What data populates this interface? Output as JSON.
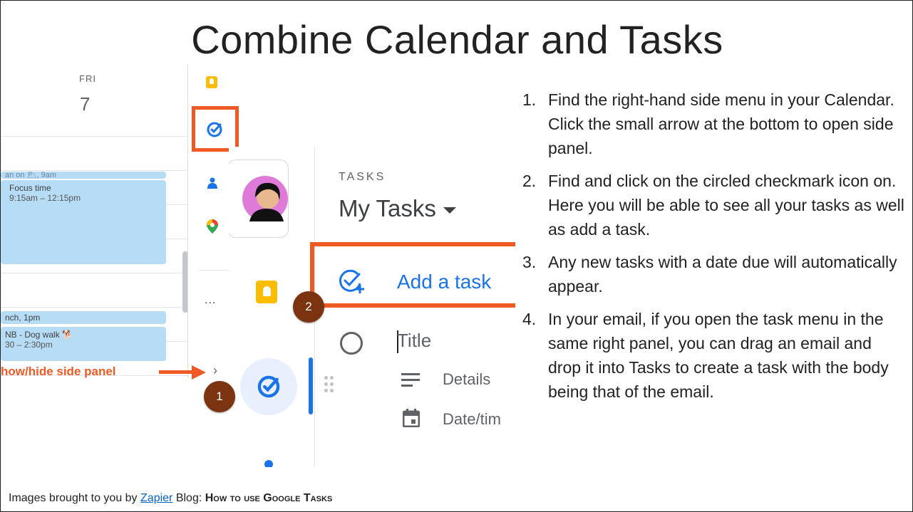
{
  "slide": {
    "title": "Combine Calendar and Tasks"
  },
  "calendar": {
    "day_name": "FRI",
    "day_number": "7",
    "events": [
      {
        "text": "an on 🌥, 9am"
      },
      {
        "title": "Focus time",
        "time": "9:15am – 12:15pm"
      },
      {
        "text": "nch, 1pm"
      },
      {
        "title": "NB - Dog walk 🐕",
        "time": "30 – 2:30pm"
      }
    ],
    "show_hide_label": "how/hide side panel"
  },
  "rail": {
    "more_label": "...",
    "expand_chevron": "›",
    "icons": [
      "keep-icon",
      "tasks-icon",
      "contacts-icon",
      "maps-icon"
    ]
  },
  "tasks_panel": {
    "section_label": "TASKS",
    "list_name": "My Tasks",
    "add_task_label": "Add a task",
    "title_placeholder": "Title",
    "details_label": "Details",
    "datetime_label": "Date/tim"
  },
  "markers": {
    "one": "1",
    "two": "2"
  },
  "steps": [
    {
      "num": "1.",
      "text": "Find the right-hand side menu in your Calendar. Click the small arrow at the bottom to open side panel."
    },
    {
      "num": "2.",
      "text": "Find and click on the circled checkmark icon on. Here you will be able to see all your tasks as well as add a task."
    },
    {
      "num": "3.",
      "text": "Any new tasks with a date due will automatically appear."
    },
    {
      "num": "4.",
      "text": "In your email, if you open the task menu in the same right panel, you can drag an email and drop it into Tasks to create a task with the body being that of the email."
    }
  ],
  "credit": {
    "prefix": "Images brought to you by",
    "link_text": "Zapier",
    "middle": "Blog:",
    "article": "How to use Google Tasks"
  },
  "colors": {
    "accent_orange": "#ef5a24",
    "event_blue": "#b7dcf5",
    "google_blue": "#1a73e8",
    "marker_brown": "#7b3310"
  }
}
